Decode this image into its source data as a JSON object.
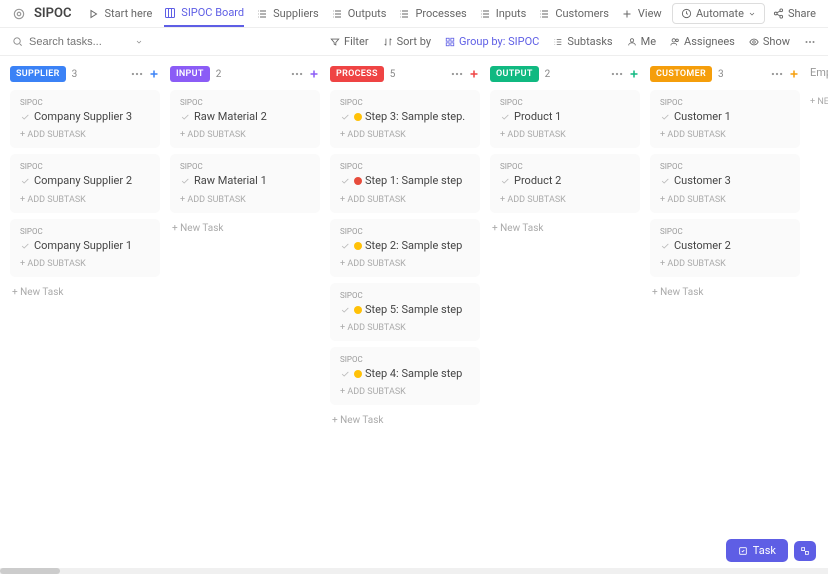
{
  "header": {
    "app_title": "SIPOC",
    "tabs": [
      {
        "label": "Start here",
        "icon": "play-icon"
      },
      {
        "label": "SIPOC Board",
        "icon": "board-icon",
        "active": true
      },
      {
        "label": "Suppliers",
        "icon": "list-icon"
      },
      {
        "label": "Outputs",
        "icon": "list-icon"
      },
      {
        "label": "Processes",
        "icon": "list-icon"
      },
      {
        "label": "Inputs",
        "icon": "list-icon"
      },
      {
        "label": "Customers",
        "icon": "list-icon"
      },
      {
        "label": "View",
        "icon": "plus-icon"
      }
    ],
    "automate_label": "Automate",
    "share_label": "Share"
  },
  "toolbar": {
    "search_placeholder": "Search tasks...",
    "filter_label": "Filter",
    "sort_label": "Sort by",
    "group_label": "Group by: SIPOC",
    "subtasks_label": "Subtasks",
    "me_label": "Me",
    "assignees_label": "Assignees",
    "show_label": "Show"
  },
  "columns": [
    {
      "name": "SUPPLIER",
      "color": "#3b82f6",
      "plus_color": "#3b82f6",
      "count": "3",
      "cards": [
        {
          "sipoc": "SIPOC",
          "title": "Company Supplier 3",
          "subtask": "+ ADD SUBTASK"
        },
        {
          "sipoc": "SIPOC",
          "title": "Company Supplier 2",
          "subtask": "+ ADD SUBTASK"
        },
        {
          "sipoc": "SIPOC",
          "title": "Company Supplier 1",
          "subtask": "+ ADD SUBTASK"
        }
      ],
      "new_task": "+ New Task"
    },
    {
      "name": "INPUT",
      "color": "#8b5cf6",
      "plus_color": "#8b5cf6",
      "count": "2",
      "cards": [
        {
          "sipoc": "SIPOC",
          "title": "Raw Material 2",
          "subtask": "+ ADD SUBTASK"
        },
        {
          "sipoc": "SIPOC",
          "title": "Raw Material 1",
          "subtask": "+ ADD SUBTASK"
        }
      ],
      "new_task": "+ New Task"
    },
    {
      "name": "PROCESS",
      "color": "#ef4444",
      "plus_color": "#ef4444",
      "count": "5",
      "cards": [
        {
          "sipoc": "SIPOC",
          "title": "Step 3: Sample step.",
          "status": "yellow",
          "subtask": "+ ADD SUBTASK"
        },
        {
          "sipoc": "SIPOC",
          "title": "Step 1: Sample step",
          "status": "red",
          "subtask": "+ ADD SUBTASK"
        },
        {
          "sipoc": "SIPOC",
          "title": "Step 2: Sample step",
          "status": "yellow",
          "subtask": "+ ADD SUBTASK"
        },
        {
          "sipoc": "SIPOC",
          "title": "Step 5: Sample step",
          "status": "yellow",
          "subtask": "+ ADD SUBTASK"
        },
        {
          "sipoc": "SIPOC",
          "title": "Step 4: Sample step",
          "status": "yellow",
          "subtask": "+ ADD SUBTASK"
        }
      ],
      "new_task": "+ New Task"
    },
    {
      "name": "OUTPUT",
      "color": "#10b981",
      "plus_color": "#10b981",
      "count": "2",
      "cards": [
        {
          "sipoc": "SIPOC",
          "title": "Product 1",
          "subtask": "+ ADD SUBTASK"
        },
        {
          "sipoc": "SIPOC",
          "title": "Product 2",
          "subtask": "+ ADD SUBTASK"
        }
      ],
      "new_task": "+ New Task"
    },
    {
      "name": "CUSTOMER",
      "color": "#f59e0b",
      "plus_color": "#f59e0b",
      "count": "3",
      "cards": [
        {
          "sipoc": "SIPOC",
          "title": "Customer 1",
          "subtask": "+ ADD SUBTASK"
        },
        {
          "sipoc": "SIPOC",
          "title": "Customer 3",
          "subtask": "+ ADD SUBTASK"
        },
        {
          "sipoc": "SIPOC",
          "title": "Customer 2",
          "subtask": "+ ADD SUBTASK"
        }
      ],
      "new_task": "+ New Task"
    }
  ],
  "empty": {
    "label": "Empty",
    "new": "+ NE"
  },
  "fab": {
    "task_label": "Task"
  }
}
